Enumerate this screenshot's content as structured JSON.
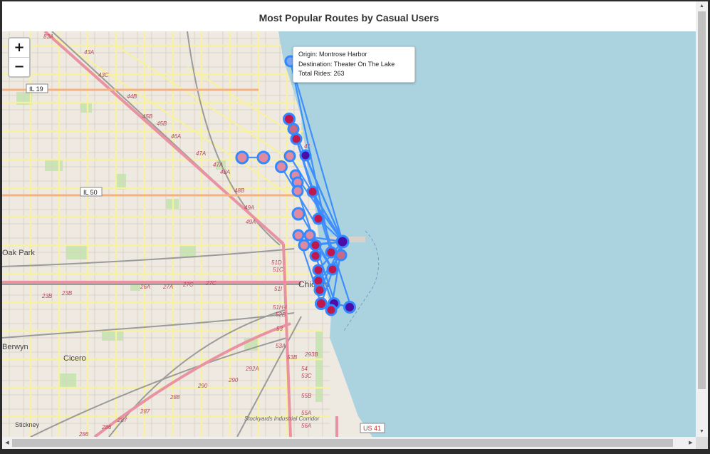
{
  "title": "Most Popular Routes by Casual Users",
  "zoom": {
    "in_label": "+",
    "out_label": "−"
  },
  "tooltip": {
    "origin": "Origin: Montrose Harbor",
    "destination": "Destination: Theater On The Lake",
    "total_rides": "Total Rides: 263"
  },
  "colors": {
    "water": "#aad3df",
    "route_line": "#3388ff",
    "marker_fill_dark": "#4b0fa8",
    "marker_fill_red": "#c0174d",
    "marker_fill_light": "#e07c95"
  },
  "map_labels": {
    "cities": [
      "Oak Park",
      "Chicago",
      "Cicero",
      "Berwyn",
      "Stickney",
      "Stockyards Industrial Corridor"
    ],
    "highway_shields": [
      "IL 19",
      "IL 50",
      "US 41"
    ],
    "exits": [
      "83A",
      "43A",
      "43C",
      "44B",
      "45B",
      "45B",
      "46A",
      "47A",
      "47A",
      "48A",
      "48B",
      "49A",
      "49A",
      "26A",
      "27A",
      "27C",
      "27C",
      "23B",
      "23B",
      "51D",
      "51C",
      "51I",
      "51H-I",
      "52B",
      "53",
      "53A",
      "53B",
      "293B",
      "292A",
      "290",
      "290",
      "288",
      "287",
      "287",
      "286",
      "286",
      "54",
      "53C",
      "55B",
      "55A",
      "56A",
      "41"
    ]
  },
  "scrollbar": {
    "up": "▲",
    "down": "▼",
    "left": "◀",
    "right": "▶"
  }
}
